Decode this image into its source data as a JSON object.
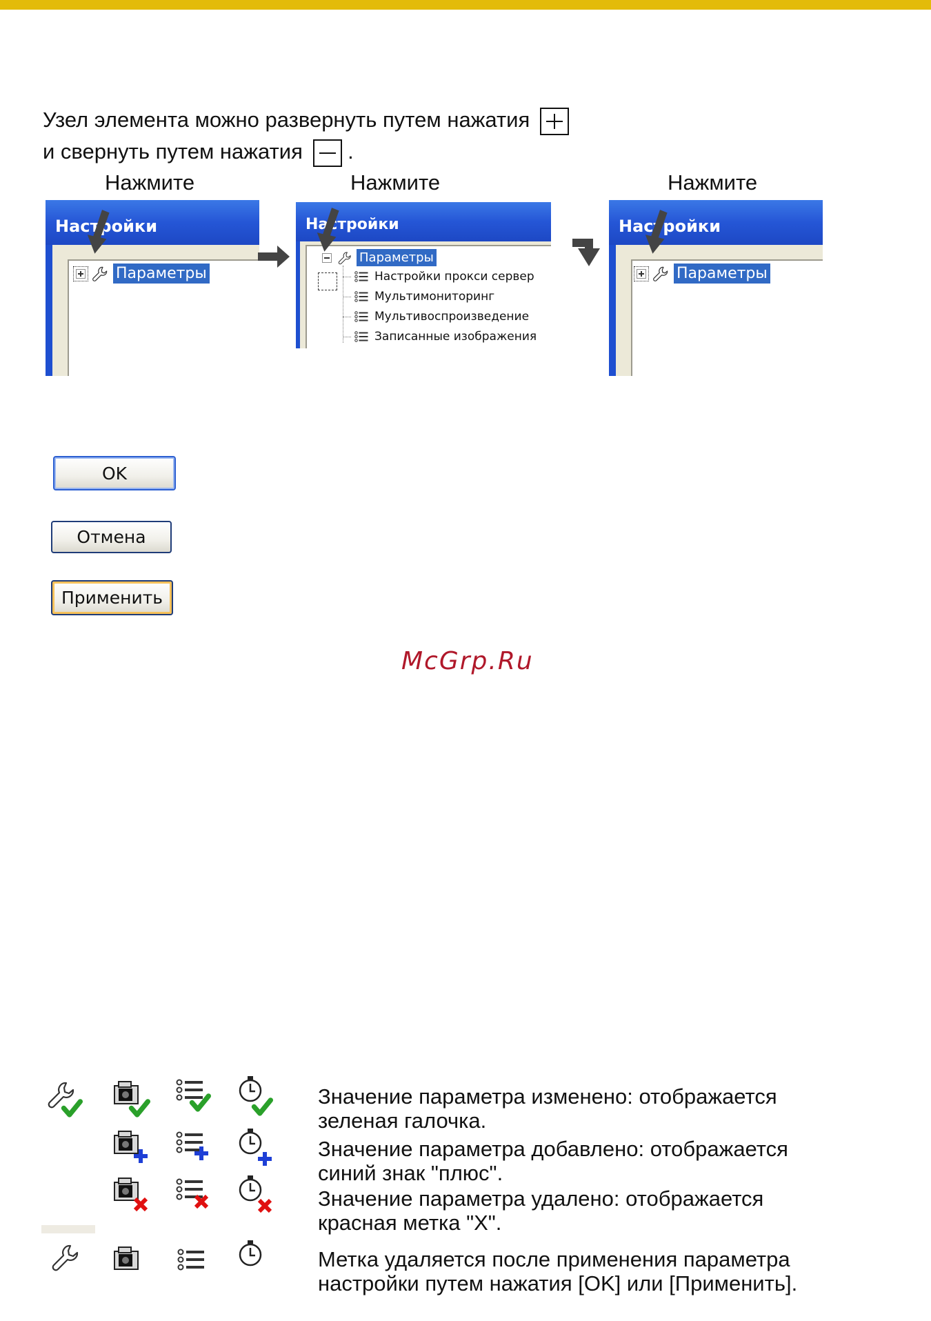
{
  "intro": {
    "line1": "Узел элемента можно развернуть путем нажатия",
    "line2": "и свернуть путем нажатия",
    "period": "."
  },
  "labels": {
    "press1": "Нажмите",
    "press2": "Нажмите",
    "press3": "Нажмите"
  },
  "panels": {
    "window_title": "Настройки",
    "root_item": "Параметры",
    "children": [
      "Настройки прокси сервер",
      "Мультимониторинг",
      "Мультивоспроизведение",
      "Записанные изображения"
    ]
  },
  "buttons": {
    "ok": "OK",
    "cancel": "Отмена",
    "apply": "Применить"
  },
  "watermark": "McGrp.Ru",
  "legend": {
    "changed_1": "Значение параметра изменено: отображается",
    "changed_2": "зеленая галочка.",
    "added_1": "Значение параметра добавлено: отображается",
    "added_2": "синий знак \"плюс\".",
    "deleted_1": "Значение параметра удалено: отображается",
    "deleted_2": "красная метка \"X\".",
    "note_1": "Метка удаляется после применения параметра",
    "note_2": "настройки путем нажатия [OK] или [Применить]."
  },
  "colors": {
    "top_bar": "#e3bb0a",
    "selection": "#316ac5",
    "check_mark": "#2aa02a",
    "plus_mark": "#1e3fd6",
    "x_mark": "#e01010"
  },
  "icons": [
    "wrench-icon",
    "camera-icon",
    "list-icon",
    "timer-icon",
    "check-mark-icon",
    "plus-mark-icon",
    "x-mark-icon"
  ]
}
